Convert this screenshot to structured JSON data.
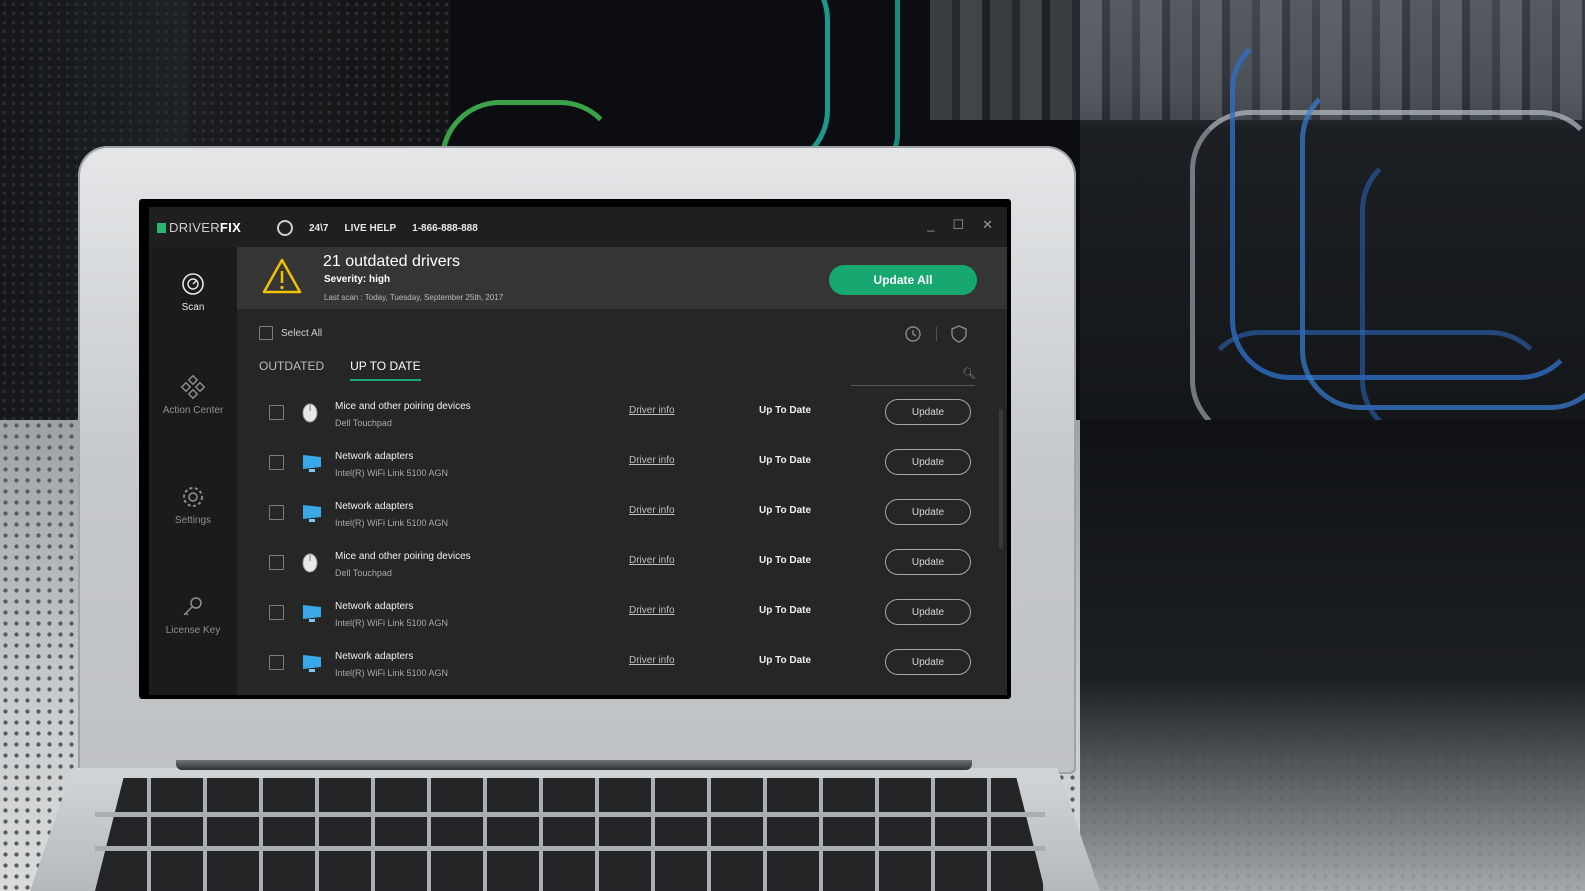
{
  "app": {
    "logo_left": "DRIVER",
    "logo_right": "FIX",
    "support_hours": "24\\7",
    "live_help": "LIVE HELP",
    "phone": "1-866-888-888",
    "window_controls": [
      "_",
      "☐",
      "✕"
    ]
  },
  "sidebar": {
    "items": [
      {
        "label": "Scan",
        "icon": "scan-icon",
        "active": true
      },
      {
        "label": "Action Center",
        "icon": "action-center-icon",
        "active": false
      },
      {
        "label": "Settings",
        "icon": "gear-icon",
        "active": false
      },
      {
        "label": "License Key",
        "icon": "key-icon",
        "active": false
      }
    ]
  },
  "banner": {
    "title": "21 outdated drivers",
    "severity": "Severity: high",
    "last_scan": "Last scan : Today, Tuesday, September 25th, 2017",
    "update_all": "Update All"
  },
  "list": {
    "select_all": "Select All",
    "tabs": [
      "OUTDATED",
      "UP TO DATE"
    ],
    "active_tab": "UP TO DATE",
    "search_placeholder": "",
    "rows": [
      {
        "name": "Mice and other poiring devices",
        "sub": "Dell Touchpad",
        "info": "Driver info",
        "status": "Up To Date",
        "action": "Update",
        "icon": "mouse-icon"
      },
      {
        "name": "Network adapters",
        "sub": "Intel(R) WiFi Link 5100 AGN",
        "info": "Driver info",
        "status": "Up To Date",
        "action": "Update",
        "icon": "monitor-icon"
      },
      {
        "name": "Network adapters",
        "sub": "Intel(R) WiFi Link 5100 AGN",
        "info": "Driver info",
        "status": "Up To Date",
        "action": "Update",
        "icon": "monitor-icon"
      },
      {
        "name": "Mice and other poiring devices",
        "sub": "Dell Touchpad",
        "info": "Driver info",
        "status": "Up To Date",
        "action": "Update",
        "icon": "mouse-icon"
      },
      {
        "name": "Network adapters",
        "sub": "Intel(R) WiFi Link 5100 AGN",
        "info": "Driver info",
        "status": "Up To Date",
        "action": "Update",
        "icon": "monitor-icon"
      },
      {
        "name": "Network adapters",
        "sub": "Intel(R) WiFi Link 5100 AGN",
        "info": "Driver info",
        "status": "Up To Date",
        "action": "Update",
        "icon": "monitor-icon"
      }
    ]
  },
  "colors": {
    "accent": "#16a86f",
    "warning": "#f2c200",
    "background": "#262626"
  }
}
